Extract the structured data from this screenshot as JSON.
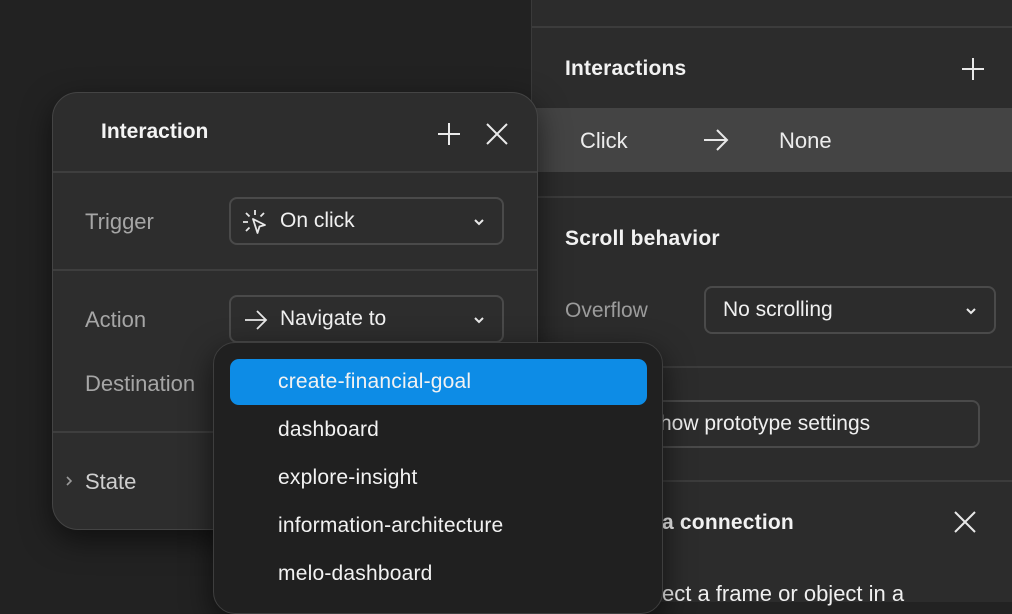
{
  "right_panel": {
    "interactions": {
      "title": "Interactions",
      "row": {
        "trigger": "Click",
        "target": "None"
      }
    },
    "scroll_behavior": {
      "title": "Scroll behavior",
      "overflow_label": "Overflow",
      "overflow_value": "No scrolling"
    },
    "prototype_button": "how prototype settings",
    "connection": {
      "title": "a connection",
      "hint": "ect a frame or object in a"
    }
  },
  "popover": {
    "title": "Interaction",
    "trigger_label": "Trigger",
    "trigger_value": "On click",
    "action_label": "Action",
    "action_value": "Navigate to",
    "destination_label": "Destination",
    "state_label": "State"
  },
  "dropdown": {
    "items": [
      {
        "label": "create-financial-goal",
        "selected": true
      },
      {
        "label": "dashboard",
        "selected": false
      },
      {
        "label": "explore-insight",
        "selected": false
      },
      {
        "label": "information-architecture",
        "selected": false
      },
      {
        "label": "melo-dashboard",
        "selected": false
      }
    ]
  },
  "colors": {
    "accent": "#0d8ce6",
    "canvas": "#222222",
    "panel": "#2c2c2c"
  }
}
